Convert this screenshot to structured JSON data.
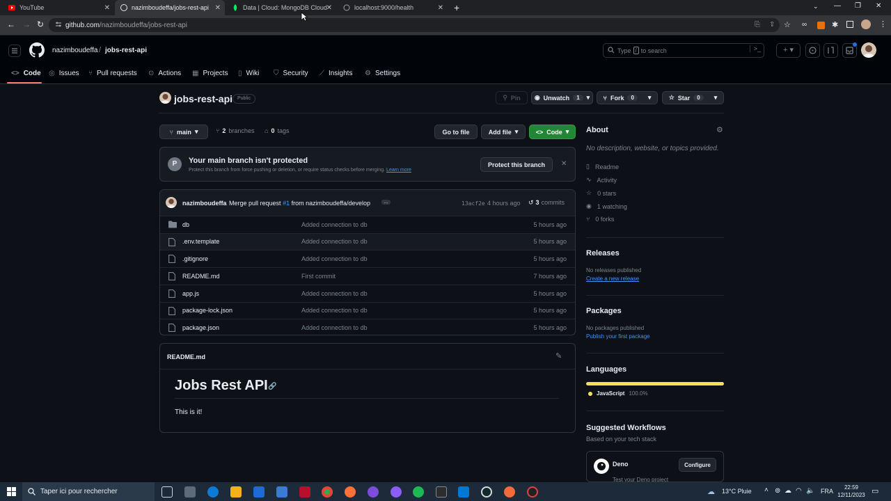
{
  "browser": {
    "tabs": [
      {
        "title": "YouTube"
      },
      {
        "title": "nazimboudeffa/jobs-rest-api"
      },
      {
        "title": "Data | Cloud: MongoDB Cloud"
      },
      {
        "title": "localhost:9000/health"
      }
    ],
    "url_host": "github.com",
    "url_path": "/nazimboudeffa/jobs-rest-api"
  },
  "header": {
    "owner": "nazimboudeffa",
    "separator": "/",
    "repo": "jobs-rest-api",
    "search_placeholder": "Type / to search",
    "search_prefix": "Type",
    "search_key": "/",
    "search_suffix": "to search"
  },
  "repo_nav": {
    "tabs": [
      "Code",
      "Issues",
      "Pull requests",
      "Actions",
      "Projects",
      "Wiki",
      "Security",
      "Insights",
      "Settings"
    ]
  },
  "repo_title": {
    "name": "jobs-rest-api",
    "visibility": "Public",
    "pin": "Pin",
    "unwatch": "Unwatch",
    "watch_count": "1",
    "fork": "Fork",
    "fork_count": "0",
    "star": "Star",
    "star_count": "0"
  },
  "toolbar": {
    "branch": "main",
    "branches_count": "2",
    "branches_label": "branches",
    "tags_count": "0",
    "tags_label": "tags",
    "goto_file": "Go to file",
    "add_file": "Add file",
    "code": "Code"
  },
  "protect": {
    "title": "Your main branch isn't protected",
    "desc": "Protect this branch from force pushing or deletion, or require status checks before merging.",
    "learn": "Learn more",
    "button": "Protect this branch"
  },
  "commit": {
    "author": "nazimboudeffa",
    "msg_prefix": "Merge pull request",
    "pr": "#1",
    "msg_suffix": "from nazimboudeffa/develop",
    "hash": "13acf2e",
    "age": "4 hours ago",
    "commits_count": "3",
    "commits_label": "commits"
  },
  "files": [
    {
      "name": "db",
      "type": "dir",
      "message": "Added connection to db",
      "age": "5 hours ago"
    },
    {
      "name": ".env.template",
      "type": "file",
      "message": "Added connection to db",
      "age": "5 hours ago"
    },
    {
      "name": ".gitignore",
      "type": "file",
      "message": "Added connection to db",
      "age": "5 hours ago"
    },
    {
      "name": "README.md",
      "type": "file",
      "message": "First commit",
      "age": "7 hours ago"
    },
    {
      "name": "app.js",
      "type": "file",
      "message": "Added connection to db",
      "age": "5 hours ago"
    },
    {
      "name": "package-lock.json",
      "type": "file",
      "message": "Added connection to db",
      "age": "5 hours ago"
    },
    {
      "name": "package.json",
      "type": "file",
      "message": "Added connection to db",
      "age": "5 hours ago"
    }
  ],
  "readme": {
    "filename": "README.md",
    "heading": "Jobs Rest API",
    "body": "This is it!"
  },
  "about": {
    "title": "About",
    "desc": "No description, website, or topics provided.",
    "items": [
      "Readme",
      "Activity",
      "0 stars",
      "1 watching",
      "0 forks"
    ]
  },
  "releases": {
    "title": "Releases",
    "none": "No releases published",
    "create": "Create a new release"
  },
  "packages": {
    "title": "Packages",
    "none": "No packages published",
    "publish": "Publish your first package"
  },
  "languages": {
    "title": "Languages",
    "name": "JavaScript",
    "percent": "100.0%",
    "color": "#f1e05a"
  },
  "workflows": {
    "title": "Suggested Workflows",
    "subtitle": "Based on your tech stack",
    "name": "Deno",
    "desc": "Test your Deno project",
    "configure": "Configure"
  },
  "taskbar": {
    "search": "Taper ici pour rechercher",
    "weather": "13°C Pluie",
    "lang": "FRA",
    "time": "22:59",
    "date": "12/11/2023"
  }
}
